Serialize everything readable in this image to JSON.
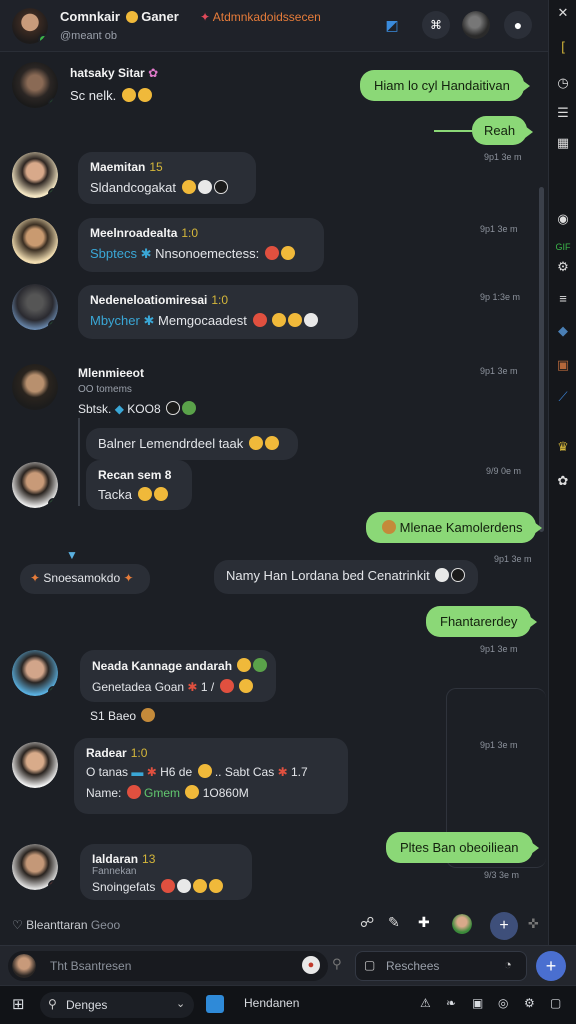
{
  "header": {
    "title": "Comnkair",
    "title_rest": "Ganer",
    "accent": "Atdmnkadoidssecen",
    "subtitle": "@meant ob",
    "close_glyph": "✕"
  },
  "rail": {
    "icons": [
      "bookmark-icon",
      "clock-icon",
      "list-icon",
      "sticker-icon",
      "globe-icon",
      "menu-icon",
      "folder-icon",
      "gif-icon",
      "pin-icon",
      "photo-icon",
      "more-icon"
    ]
  },
  "messages_in": [
    {
      "name": "hatsaky Sitar",
      "text": "Sc nelk.",
      "badge": ""
    },
    {
      "name": "Maemitan",
      "badge": "15",
      "text": "Sldandcogakat"
    },
    {
      "name": "Meelnroadealta",
      "badge": "1:0",
      "text_blue": "Sbptecs",
      "text": "Nnsonoemectess:"
    },
    {
      "name": "Nedeneloatiomiresai",
      "badge": "1:0",
      "text_blue": "Mbycher",
      "text": "Memgocaadest"
    },
    {
      "name": "Mlenmieeot",
      "badge": "",
      "line1": "OO tomems",
      "text": "Sbtsk.",
      "extra": "KOO8"
    },
    {
      "name": "",
      "badge": "",
      "text": "Balner Lemendrdeel taak"
    },
    {
      "name": "Recan sem 8",
      "badge": "",
      "text": "Tacka"
    },
    {
      "name": "Neada Kannage andarah",
      "badge": "",
      "text": "Genetadea Goan",
      "extra": "1 /"
    },
    {
      "name": "Radear",
      "badge": "1:0",
      "line1": "O tanas",
      "line1b": "H6 de",
      "line1c": ".. Sabt Cas",
      "line1d": "1.7",
      "line2": "Name:",
      "line2_green": "Gmem",
      "line2b": "1O860M"
    },
    {
      "name": "Ialdaran",
      "badge": "13",
      "line1": "Fannekan",
      "text": "Snoingefats"
    }
  ],
  "messages_out": [
    {
      "text": "Hiam lo cyl Handaitivan"
    },
    {
      "text": "Reah"
    },
    {
      "text": "Mlenae Kamolerdens"
    },
    {
      "text": "Fhantarerdey"
    },
    {
      "text": "Pltes Ban obeoiliean"
    }
  ],
  "center_messages": [
    {
      "text": "Namy Han Lordana bed Cenatrinkit"
    },
    {
      "text": "Snoesamokdo"
    }
  ],
  "timestamps": [
    "9p1 3e m",
    "9p1 3e m",
    "9p 1:3e m",
    "9p1 3e m",
    "9/9 0e m",
    "9p1 3e m",
    "9p1 3e m",
    "9p1 3e m",
    "9/3 3e m",
    "9/3 3e m"
  ],
  "reaction_label": "S1 Baeo",
  "typing": {
    "name": "Bleanttaran",
    "extra": "Geoo"
  },
  "compose": {
    "placeholder": "Tht Bsantresen",
    "search_placeholder": "Reschees"
  },
  "taskbar": {
    "search": "Denges",
    "app": "Hendanen"
  }
}
